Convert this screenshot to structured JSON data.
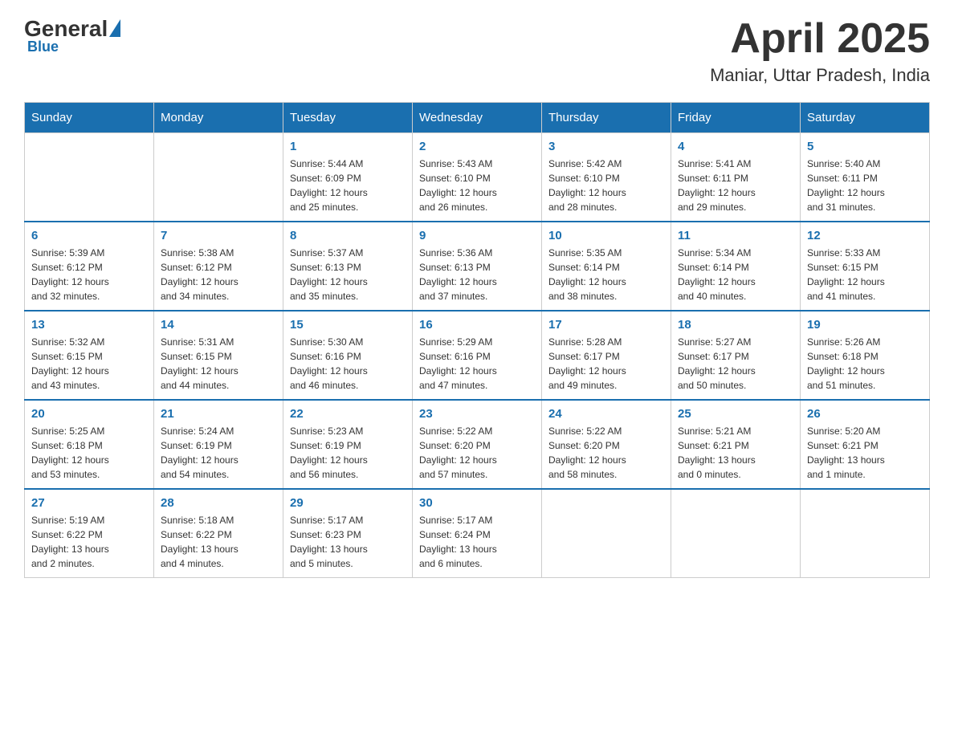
{
  "logo": {
    "general": "General",
    "blue": "Blue"
  },
  "title": "April 2025",
  "subtitle": "Maniar, Uttar Pradesh, India",
  "days_of_week": [
    "Sunday",
    "Monday",
    "Tuesday",
    "Wednesday",
    "Thursday",
    "Friday",
    "Saturday"
  ],
  "weeks": [
    [
      {
        "day": "",
        "info": ""
      },
      {
        "day": "",
        "info": ""
      },
      {
        "day": "1",
        "info": "Sunrise: 5:44 AM\nSunset: 6:09 PM\nDaylight: 12 hours\nand 25 minutes."
      },
      {
        "day": "2",
        "info": "Sunrise: 5:43 AM\nSunset: 6:10 PM\nDaylight: 12 hours\nand 26 minutes."
      },
      {
        "day": "3",
        "info": "Sunrise: 5:42 AM\nSunset: 6:10 PM\nDaylight: 12 hours\nand 28 minutes."
      },
      {
        "day": "4",
        "info": "Sunrise: 5:41 AM\nSunset: 6:11 PM\nDaylight: 12 hours\nand 29 minutes."
      },
      {
        "day": "5",
        "info": "Sunrise: 5:40 AM\nSunset: 6:11 PM\nDaylight: 12 hours\nand 31 minutes."
      }
    ],
    [
      {
        "day": "6",
        "info": "Sunrise: 5:39 AM\nSunset: 6:12 PM\nDaylight: 12 hours\nand 32 minutes."
      },
      {
        "day": "7",
        "info": "Sunrise: 5:38 AM\nSunset: 6:12 PM\nDaylight: 12 hours\nand 34 minutes."
      },
      {
        "day": "8",
        "info": "Sunrise: 5:37 AM\nSunset: 6:13 PM\nDaylight: 12 hours\nand 35 minutes."
      },
      {
        "day": "9",
        "info": "Sunrise: 5:36 AM\nSunset: 6:13 PM\nDaylight: 12 hours\nand 37 minutes."
      },
      {
        "day": "10",
        "info": "Sunrise: 5:35 AM\nSunset: 6:14 PM\nDaylight: 12 hours\nand 38 minutes."
      },
      {
        "day": "11",
        "info": "Sunrise: 5:34 AM\nSunset: 6:14 PM\nDaylight: 12 hours\nand 40 minutes."
      },
      {
        "day": "12",
        "info": "Sunrise: 5:33 AM\nSunset: 6:15 PM\nDaylight: 12 hours\nand 41 minutes."
      }
    ],
    [
      {
        "day": "13",
        "info": "Sunrise: 5:32 AM\nSunset: 6:15 PM\nDaylight: 12 hours\nand 43 minutes."
      },
      {
        "day": "14",
        "info": "Sunrise: 5:31 AM\nSunset: 6:15 PM\nDaylight: 12 hours\nand 44 minutes."
      },
      {
        "day": "15",
        "info": "Sunrise: 5:30 AM\nSunset: 6:16 PM\nDaylight: 12 hours\nand 46 minutes."
      },
      {
        "day": "16",
        "info": "Sunrise: 5:29 AM\nSunset: 6:16 PM\nDaylight: 12 hours\nand 47 minutes."
      },
      {
        "day": "17",
        "info": "Sunrise: 5:28 AM\nSunset: 6:17 PM\nDaylight: 12 hours\nand 49 minutes."
      },
      {
        "day": "18",
        "info": "Sunrise: 5:27 AM\nSunset: 6:17 PM\nDaylight: 12 hours\nand 50 minutes."
      },
      {
        "day": "19",
        "info": "Sunrise: 5:26 AM\nSunset: 6:18 PM\nDaylight: 12 hours\nand 51 minutes."
      }
    ],
    [
      {
        "day": "20",
        "info": "Sunrise: 5:25 AM\nSunset: 6:18 PM\nDaylight: 12 hours\nand 53 minutes."
      },
      {
        "day": "21",
        "info": "Sunrise: 5:24 AM\nSunset: 6:19 PM\nDaylight: 12 hours\nand 54 minutes."
      },
      {
        "day": "22",
        "info": "Sunrise: 5:23 AM\nSunset: 6:19 PM\nDaylight: 12 hours\nand 56 minutes."
      },
      {
        "day": "23",
        "info": "Sunrise: 5:22 AM\nSunset: 6:20 PM\nDaylight: 12 hours\nand 57 minutes."
      },
      {
        "day": "24",
        "info": "Sunrise: 5:22 AM\nSunset: 6:20 PM\nDaylight: 12 hours\nand 58 minutes."
      },
      {
        "day": "25",
        "info": "Sunrise: 5:21 AM\nSunset: 6:21 PM\nDaylight: 13 hours\nand 0 minutes."
      },
      {
        "day": "26",
        "info": "Sunrise: 5:20 AM\nSunset: 6:21 PM\nDaylight: 13 hours\nand 1 minute."
      }
    ],
    [
      {
        "day": "27",
        "info": "Sunrise: 5:19 AM\nSunset: 6:22 PM\nDaylight: 13 hours\nand 2 minutes."
      },
      {
        "day": "28",
        "info": "Sunrise: 5:18 AM\nSunset: 6:22 PM\nDaylight: 13 hours\nand 4 minutes."
      },
      {
        "day": "29",
        "info": "Sunrise: 5:17 AM\nSunset: 6:23 PM\nDaylight: 13 hours\nand 5 minutes."
      },
      {
        "day": "30",
        "info": "Sunrise: 5:17 AM\nSunset: 6:24 PM\nDaylight: 13 hours\nand 6 minutes."
      },
      {
        "day": "",
        "info": ""
      },
      {
        "day": "",
        "info": ""
      },
      {
        "day": "",
        "info": ""
      }
    ]
  ]
}
